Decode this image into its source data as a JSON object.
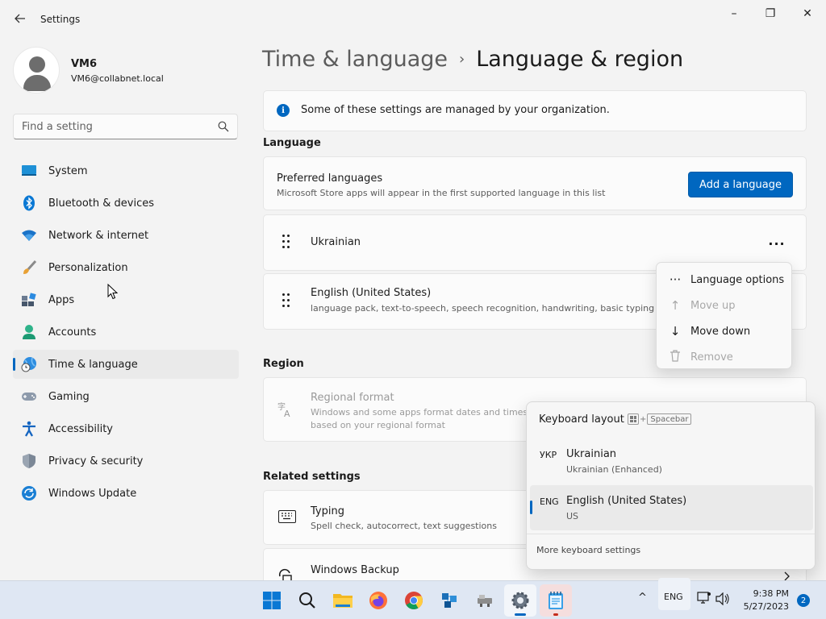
{
  "window": {
    "title": "Settings",
    "minimize_glyph": "–",
    "maximize_glyph": "❐",
    "close_glyph": "✕"
  },
  "profile": {
    "name": "VM6",
    "email": "VM6@collabnet.local"
  },
  "search": {
    "placeholder": "Find a setting"
  },
  "sidebar": {
    "items": [
      {
        "label": "System",
        "icon": "system-icon"
      },
      {
        "label": "Bluetooth & devices",
        "icon": "bluetooth-icon"
      },
      {
        "label": "Network & internet",
        "icon": "wifi-icon"
      },
      {
        "label": "Personalization",
        "icon": "brush-icon"
      },
      {
        "label": "Apps",
        "icon": "apps-icon"
      },
      {
        "label": "Accounts",
        "icon": "accounts-icon"
      },
      {
        "label": "Time & language",
        "icon": "globe-clock-icon",
        "active": true
      },
      {
        "label": "Gaming",
        "icon": "gamepad-icon"
      },
      {
        "label": "Accessibility",
        "icon": "accessibility-icon"
      },
      {
        "label": "Privacy & security",
        "icon": "shield-icon"
      },
      {
        "label": "Windows Update",
        "icon": "update-icon"
      }
    ]
  },
  "breadcrumb": {
    "parent": "Time & language",
    "separator": "›",
    "current": "Language & region"
  },
  "info_banner": {
    "icon_glyph": "i",
    "text": "Some of these settings are managed by your organization."
  },
  "language_section": {
    "title": "Language",
    "preferred": {
      "title": "Preferred languages",
      "subtitle": "Microsoft Store apps will appear in the first supported language in this list",
      "button": "Add a language"
    },
    "languages": [
      {
        "name": "Ukrainian",
        "detail": ""
      },
      {
        "name": "English (United States)",
        "detail": "language pack, text-to-speech, speech recognition, handwriting, basic typing"
      }
    ],
    "more_glyph": "···"
  },
  "context_menu": {
    "items": [
      {
        "label": "Language options",
        "icon_glyph": "···",
        "enabled": true
      },
      {
        "label": "Move up",
        "icon_glyph": "↑",
        "enabled": false
      },
      {
        "label": "Move down",
        "icon_glyph": "↓",
        "enabled": true
      },
      {
        "label": "Remove",
        "icon_glyph": "🗑",
        "enabled": false
      }
    ]
  },
  "region_section": {
    "title": "Region",
    "format": {
      "title": "Regional format",
      "subtitle": "Windows and some apps format dates and times based on your regional format"
    }
  },
  "related_section": {
    "title": "Related settings",
    "items": [
      {
        "title": "Typing",
        "subtitle": "Spell check, autocorrect, text suggestions"
      },
      {
        "title": "Windows Backup",
        "subtitle": ""
      }
    ]
  },
  "keyboard_flyout": {
    "title": "Keyboard layout",
    "shortcut_plus": "+",
    "shortcut_key": "Spacebar",
    "layouts": [
      {
        "code": "УКР",
        "name": "Ukrainian",
        "detail": "Ukrainian (Enhanced)",
        "selected": false
      },
      {
        "code": "ENG",
        "name": "English (United States)",
        "detail": "US",
        "selected": true
      }
    ],
    "more_link": "More keyboard settings"
  },
  "taskbar": {
    "input_indicator": "ENG",
    "time": "9:38 PM",
    "date": "5/27/2023",
    "notification_count": "2",
    "chevron_glyph": "^"
  },
  "colors": {
    "accent": "#0067c0",
    "background": "#f3f3f3",
    "card": "#fbfbfb",
    "taskbar": "#dfe7f3"
  }
}
